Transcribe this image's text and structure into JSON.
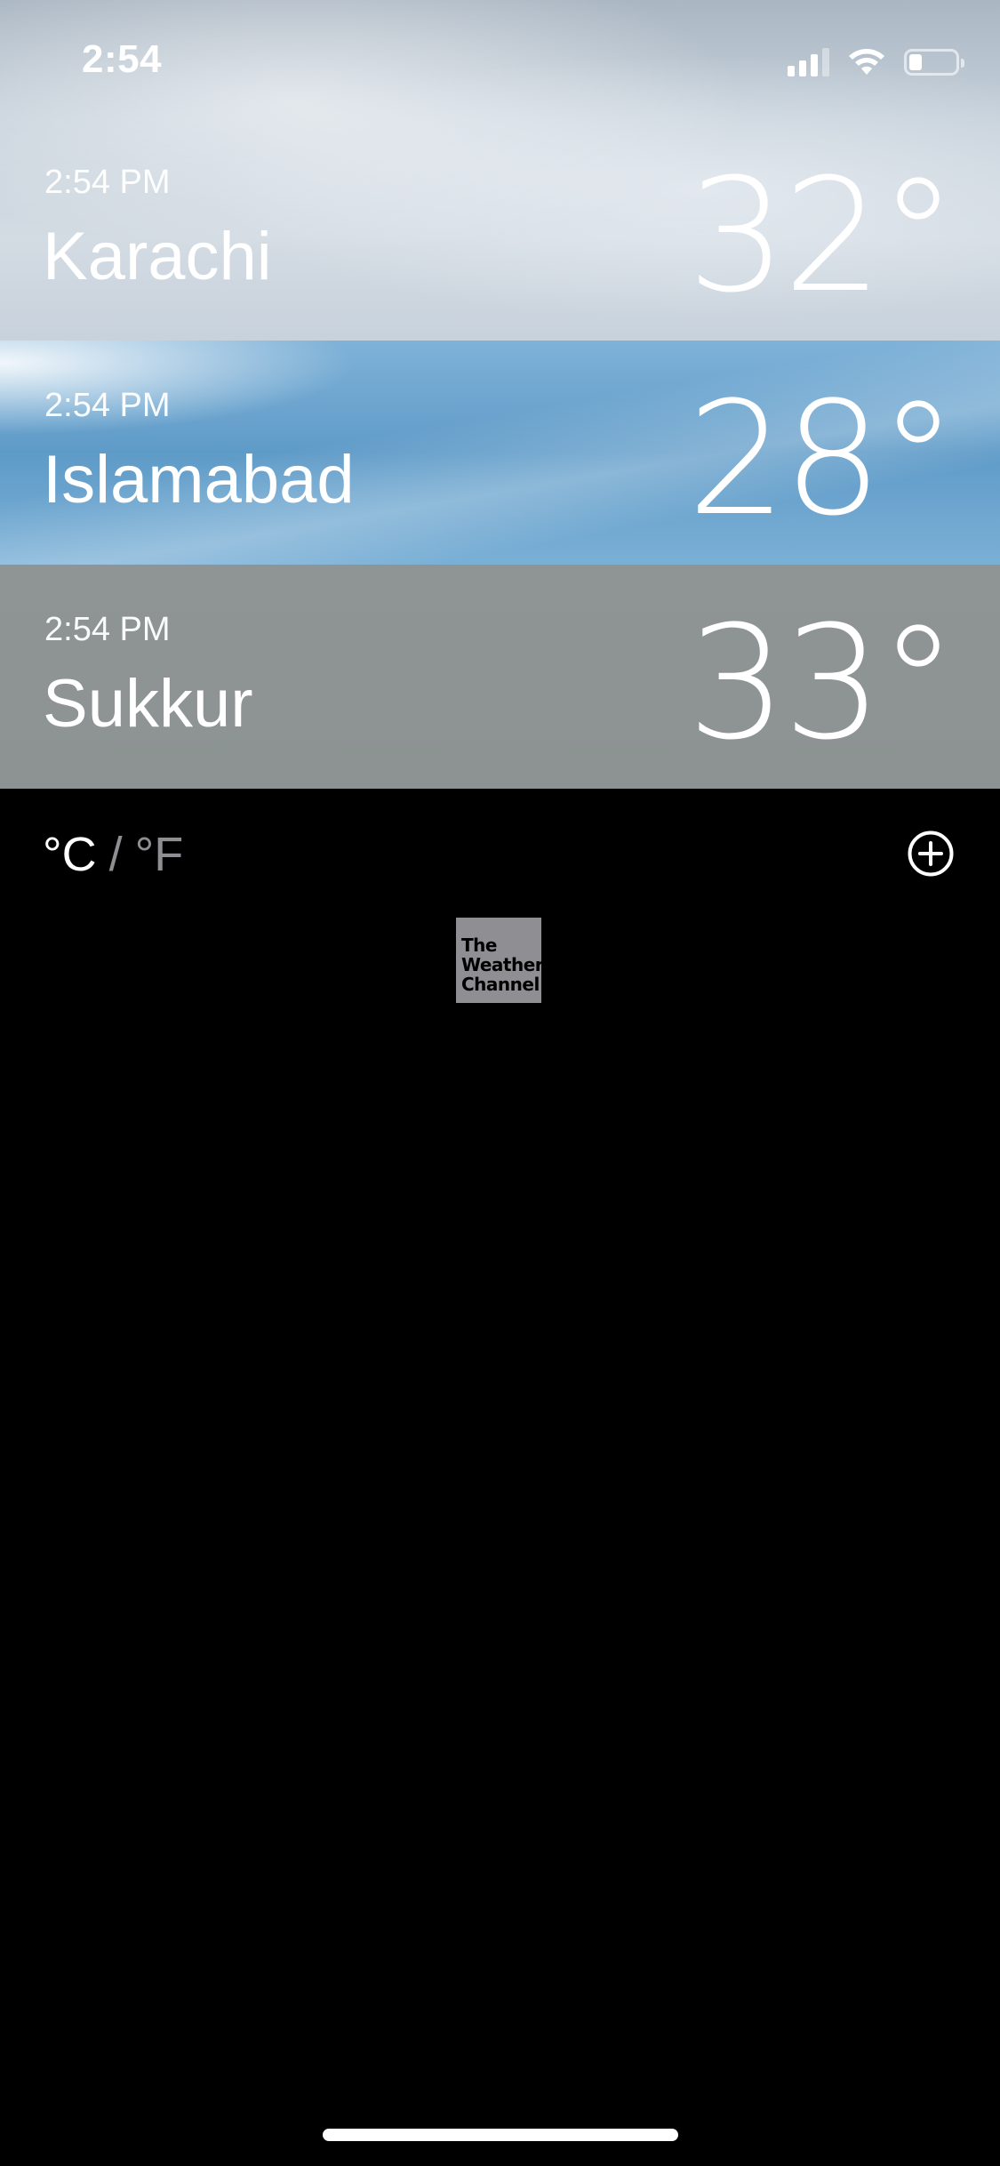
{
  "status_bar": {
    "time": "2:54",
    "signal_icon": "cellular-signal-icon",
    "wifi_icon": "wifi-icon",
    "battery_icon": "battery-icon",
    "battery_level": 0.2
  },
  "cities": [
    {
      "time": "2:54 PM",
      "name": "Karachi",
      "temp": "32°",
      "background": "cloudy-sky"
    },
    {
      "time": "2:54 PM",
      "name": "Islamabad",
      "temp": "28°",
      "background": "blue-sky"
    },
    {
      "time": "2:54 PM",
      "name": "Sukkur",
      "temp": "33°",
      "background": "gray-haze"
    }
  ],
  "units": {
    "celsius": "°C",
    "separator": "/",
    "fahrenheit": "°F",
    "selected": "°C"
  },
  "add_button_icon": "plus-circle-icon",
  "logo": {
    "line1": "The",
    "line2": "Weather",
    "line3": "Channel"
  },
  "colors": {
    "background": "#000000",
    "inactive_unit": "#8e8e93",
    "logo_bg": "#8e8e93"
  }
}
